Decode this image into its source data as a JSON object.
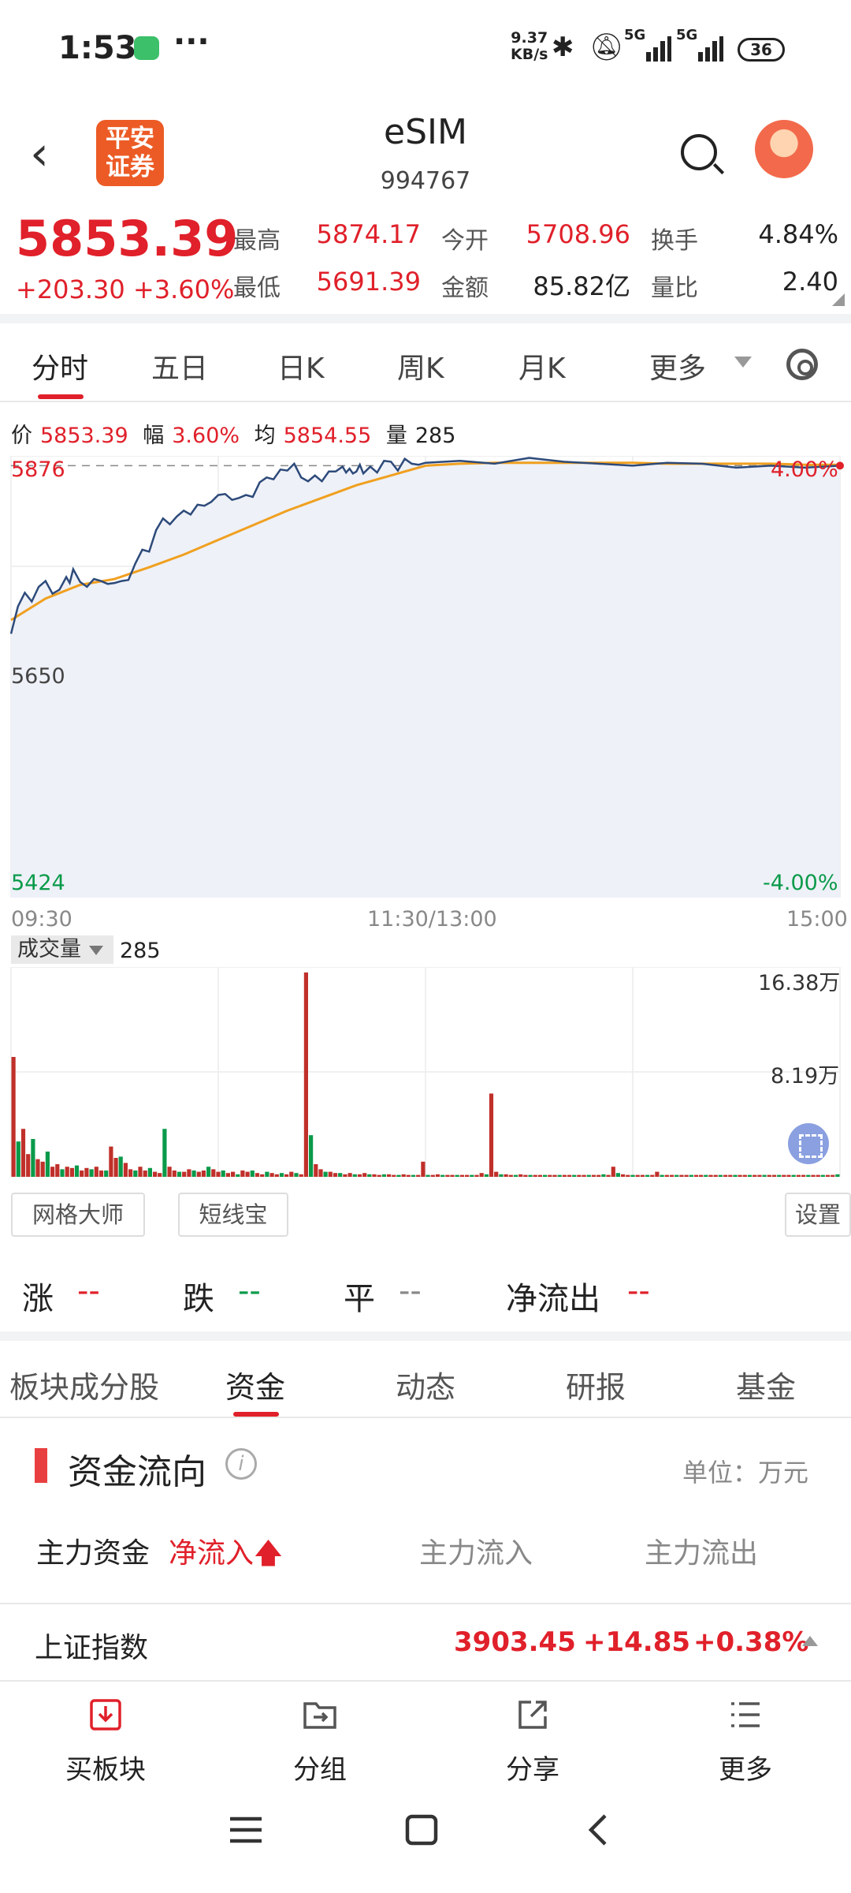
{
  "status_bar": {
    "time": "1:53",
    "more": "···",
    "net_speed_value": "9.37",
    "net_speed_unit": "KB/s",
    "signal1": "5G",
    "signal2": "5G",
    "battery": "36"
  },
  "header": {
    "logo_line1": "平安",
    "logo_line2": "证券",
    "title": "eSIM",
    "code": "994767"
  },
  "quote": {
    "price": "5853.39",
    "change": "+203.30",
    "change_pct": "+3.60%",
    "high_label": "最高",
    "high": "5874.17",
    "low_label": "最低",
    "low": "5691.39",
    "open_label": "今开",
    "open": "5708.96",
    "amount_label": "金额",
    "amount": "85.82亿",
    "turnover_label": "换手",
    "turnover": "4.84%",
    "vol_ratio_label": "量比",
    "vol_ratio": "2.40"
  },
  "kline_tabs": [
    "分时",
    "五日",
    "日K",
    "周K",
    "月K",
    "更多"
  ],
  "chart_info": {
    "price_label": "价",
    "price": "5853.39",
    "amp_label": "幅",
    "amp": "3.60%",
    "avg_label": "均",
    "avg": "5854.55",
    "vol_label": "量",
    "vol": "285"
  },
  "chart_data": {
    "type": "line",
    "y_axis_left": [
      "5876",
      "5650",
      "5424"
    ],
    "y_axis_right": [
      "4.00%",
      "-4.00%"
    ],
    "x_axis": [
      "09:30",
      "11:30/13:00",
      "15:00"
    ],
    "ylim": [
      5424,
      5876
    ],
    "prev_close": 5650,
    "series": [
      {
        "name": "价",
        "color": "#2d4a7a",
        "x": [
          0,
          2,
          4,
          6,
          8,
          10,
          12,
          14,
          16,
          17,
          18,
          20,
          22,
          24,
          26,
          28,
          30,
          32,
          34,
          36,
          38,
          40,
          42,
          44,
          46,
          48,
          50,
          52,
          54,
          56,
          58,
          60,
          62,
          64,
          66,
          68,
          70,
          72,
          74,
          76,
          78,
          80,
          82,
          84,
          86,
          88,
          90,
          92,
          94,
          96,
          97,
          98,
          99,
          100,
          101,
          102,
          104,
          106,
          108,
          110,
          112,
          114,
          116,
          118,
          120
        ],
        "values": [
          5694,
          5722,
          5736,
          5727,
          5742,
          5748,
          5735,
          5739,
          5752,
          5746,
          5760,
          5747,
          5742,
          5750,
          5748,
          5745,
          5746,
          5748,
          5749,
          5766,
          5780,
          5778,
          5800,
          5812,
          5806,
          5814,
          5820,
          5816,
          5826,
          5825,
          5829,
          5836,
          5837,
          5831,
          5833,
          5836,
          5834,
          5849,
          5854,
          5852,
          5862,
          5861,
          5868,
          5854,
          5850,
          5856,
          5850,
          5860,
          5860,
          5865,
          5859,
          5863,
          5858,
          5860,
          5867,
          5858,
          5865,
          5859,
          5871,
          5870,
          5861,
          5873,
          5868,
          5867,
          5869
        ]
      },
      {
        "name": "均",
        "color": "#f0a020",
        "x": [
          0,
          10,
          20,
          30,
          40,
          50,
          60,
          70,
          80,
          90,
          100,
          110,
          120
        ],
        "values": [
          5708,
          5730,
          5744,
          5750,
          5762,
          5775,
          5790,
          5805,
          5820,
          5833,
          5846,
          5856,
          5866
        ]
      }
    ],
    "series_tail": {
      "x": [
        120,
        130,
        140,
        150,
        160,
        170,
        180,
        190,
        200,
        210,
        220,
        230,
        240
      ],
      "price": [
        5869,
        5871,
        5868,
        5874,
        5870,
        5868,
        5866,
        5869,
        5868,
        5864,
        5866,
        5864,
        5866
      ],
      "avg": [
        5866,
        5868,
        5869,
        5869,
        5869,
        5869,
        5869,
        5868,
        5868,
        5868,
        5868,
        5867,
        5867
      ]
    },
    "volume": {
      "label": "成交量",
      "current": "285",
      "y_ticks": [
        "16.38万",
        "8.19万"
      ],
      "ymax": 163800,
      "values": [
        95000,
        28000,
        38000,
        18000,
        30000,
        14000,
        12000,
        20000,
        8000,
        10000,
        6000,
        8000,
        7000,
        9000,
        5000,
        7000,
        6000,
        8000,
        5000,
        5000,
        24000,
        15000,
        16000,
        11000,
        6000,
        5000,
        8000,
        5000,
        7000,
        4000,
        3000,
        38000,
        8000,
        5000,
        4000,
        4000,
        6000,
        5000,
        4000,
        5000,
        8000,
        6000,
        4000,
        5000,
        3000,
        4000,
        2000,
        5000,
        4000,
        5000,
        3000,
        2000,
        4000,
        3000,
        2000,
        3000,
        2000,
        4000,
        3000,
        2000,
        162000,
        33000,
        10000,
        6000,
        4000,
        4000,
        3000,
        3000,
        2000,
        3000,
        2000,
        2000,
        3000,
        2000,
        2000,
        1500,
        2000,
        2000,
        1500,
        1500,
        2000,
        1500,
        1500,
        1500,
        12000,
        1500,
        1500,
        2000,
        1500,
        1500,
        1500,
        1500,
        1500,
        1500,
        1500,
        1500,
        3000,
        2000,
        66000,
        4000,
        2000,
        2000,
        1500,
        1500,
        2000,
        1500,
        1500,
        1500,
        1500,
        1500,
        1500,
        1500,
        1500,
        1500,
        1500,
        1500,
        1500,
        1500,
        1500,
        1500,
        1500,
        2000,
        1500,
        8000,
        3000,
        2000,
        1500,
        1500,
        1500,
        1500,
        1500,
        1500,
        4000,
        1500,
        1500,
        1500,
        1500,
        1500,
        1500,
        1500,
        1500,
        1500,
        1500,
        1500,
        1500,
        1500,
        1500,
        1500,
        1500,
        1500,
        1500,
        1500,
        1500,
        1500,
        1500,
        1500,
        1500,
        1500,
        1500,
        1500,
        1500,
        1500,
        1500,
        1500,
        1500,
        1500,
        1500,
        1500,
        1500,
        2000
      ]
    }
  },
  "tools": {
    "grid": "网格大师",
    "short": "短线宝",
    "settings": "设置"
  },
  "stats": {
    "up_label": "涨",
    "up": "--",
    "down_label": "跌",
    "down": "--",
    "flat_label": "平",
    "flat": "--",
    "net_label": "净流出",
    "net": "--"
  },
  "section_tabs": [
    "板块成分股",
    "资金",
    "动态",
    "研报",
    "基金"
  ],
  "fund_flow": {
    "title": "资金流向",
    "info": "i",
    "unit": "单位：万元",
    "col1": "主力资金",
    "col1_state": "净流入",
    "col2": "主力流入",
    "col3": "主力流出"
  },
  "index_bar": {
    "name": "上证指数",
    "value": "3903.45",
    "change": "+14.85",
    "change_pct": "+0.38%"
  },
  "actions": [
    "买板块",
    "分组",
    "分享",
    "更多"
  ],
  "colors": {
    "up": "#e0202a",
    "down": "#0a9a4a",
    "price_line": "#2d4a7a",
    "avg_line": "#f0a020"
  }
}
